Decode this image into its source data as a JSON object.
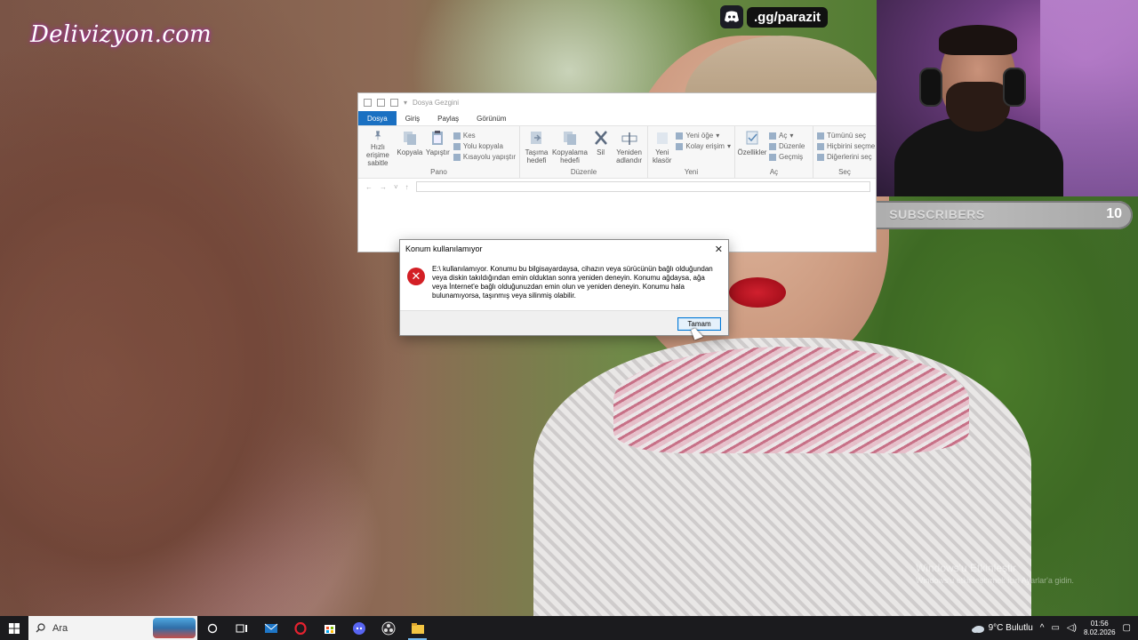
{
  "overlay": {
    "brand": "Delivizyon.com",
    "discord_handle": ".gg/parazit",
    "subscribers": {
      "current": "0",
      "label": "SUBSCRIBERS",
      "goal": "10",
      "progress": 0.05
    }
  },
  "explorer": {
    "title": "Dosya Gezgini",
    "tabs": [
      "Dosya",
      "Giriş",
      "Paylaş",
      "Görünüm"
    ],
    "groups": {
      "pano": {
        "name": "Pano",
        "pin": "Hızlı erişime sabitle",
        "copy": "Kopyala",
        "paste": "Yapıştır",
        "cut": "Kes",
        "copy_path": "Yolu kopyala",
        "paste_shortcut": "Kısayolu yapıştır"
      },
      "duzenle": {
        "name": "Düzenle",
        "move": "Taşıma hedefi",
        "copyto": "Kopyalama hedefi",
        "delete": "Sil",
        "rename": "Yeniden adlandır"
      },
      "yeni": {
        "name": "Yeni",
        "new_folder": "Yeni klasör",
        "new_item": "Yeni öğe",
        "easy_access": "Kolay erişim"
      },
      "ac": {
        "name": "Aç",
        "properties": "Özellikler",
        "open": "Aç",
        "edit": "Düzenle",
        "history": "Geçmiş"
      },
      "sec": {
        "name": "Seç",
        "select_all": "Tümünü seç",
        "select_none": "Hiçbirini seçme",
        "invert": "Diğerlerini seç"
      }
    }
  },
  "dialog": {
    "title": "Konum kullanılamıyor",
    "message": "E:\\ kullanılamıyor. Konumu bu bilgisayardaysa, cihazın veya sürücünün bağlı olduğundan veya diskin takıldığından emin olduktan sonra yeniden deneyin. Konumu ağdaysa, ağa veya İnternet'e bağlı olduğunuzdan emin olun ve yeniden deneyin. Konumu hala bulunamıyorsa, taşınmış veya silinmiş olabilir.",
    "ok_label": "Tamam"
  },
  "watermark": {
    "line1": "Windows'u Etkinleştir",
    "line2": "Windows'u etkinleştirmek için Ayarlar'a gidin."
  },
  "taskbar": {
    "search_placeholder": "Ara",
    "weather": "9°C  Bulutlu",
    "time": "01:56",
    "date": "8.02.2026"
  }
}
